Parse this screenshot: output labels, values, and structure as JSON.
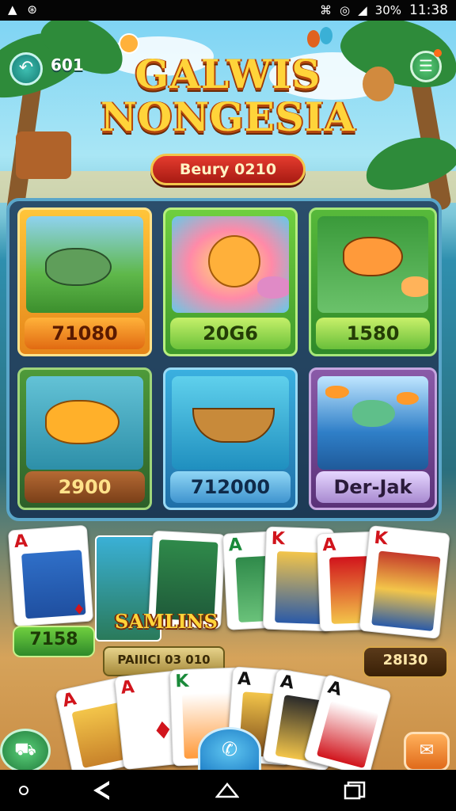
{
  "status_bar": {
    "left_icons": [
      "warning-icon",
      "sync-icon"
    ],
    "right_icons": [
      "nfc-icon",
      "alarm-icon",
      "signal-icon"
    ],
    "battery": "30%",
    "time": "11:38"
  },
  "header": {
    "coins": "601",
    "title_line1": "GALWIS",
    "title_line2": "NONGESIA",
    "banner": "Beury 0210"
  },
  "games": [
    {
      "value": "71080",
      "color": "#f29a1e"
    },
    {
      "value": "20G6",
      "color": "#67c23c"
    },
    {
      "value": "1580",
      "color": "#5cbf3b"
    },
    {
      "value": "2900",
      "color": "#9c5a2a"
    },
    {
      "value": "712000",
      "color": "#3a8bd0"
    },
    {
      "value": "Der-Jak",
      "color": "#7a4b9a"
    }
  ],
  "card_section": {
    "card_value": "7158",
    "samlins_label": "SAMLINS",
    "small_label": "PAIIICI 03 010",
    "right_value": "28I30"
  },
  "cards": [
    {
      "rank": "A",
      "suit": "♦"
    },
    {
      "rank": "A",
      "suit": "♣"
    },
    {
      "rank": "K",
      "suit": "♦"
    },
    {
      "rank": "A",
      "suit": "♦"
    },
    {
      "rank": "K",
      "suit": "♦"
    },
    {
      "rank": "A",
      "suit": "♦"
    },
    {
      "rank": "A",
      "suit": "♦"
    },
    {
      "rank": "K",
      "suit": "♣"
    },
    {
      "rank": "A",
      "suit": "♠"
    },
    {
      "rank": "A",
      "suit": "♠"
    },
    {
      "rank": "A",
      "suit": "♣"
    }
  ]
}
